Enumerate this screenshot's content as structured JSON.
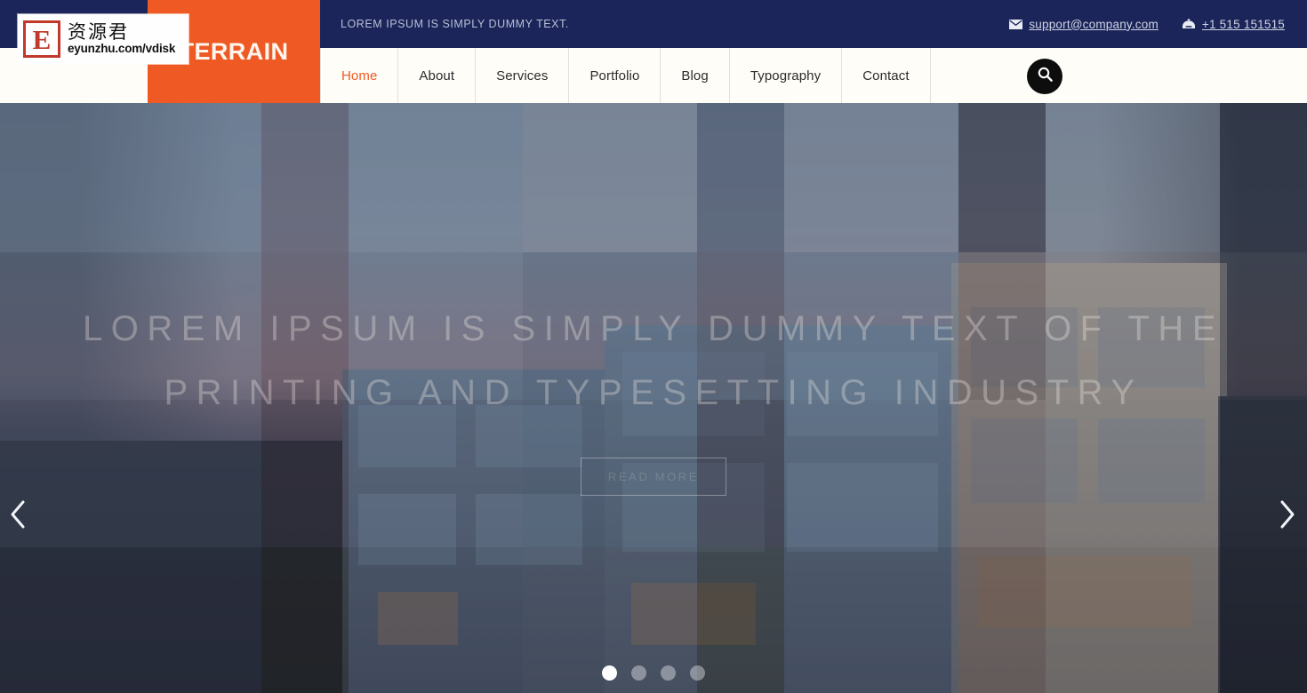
{
  "topbar": {
    "tagline": "LOREM IPSUM IS SIMPLY DUMMY TEXT.",
    "email": "support@company.com",
    "phone": "+1 515 151515",
    "email_icon": "envelope-icon",
    "phone_icon": "phone-icon",
    "bg_color": "#1b2559"
  },
  "logo": {
    "text": "TERRAIN",
    "bg_color": "#ef5a24",
    "text_color": "#fdf6ee"
  },
  "nav": {
    "bg_color": "#fffdf8",
    "active_color": "#ef5a24",
    "items": [
      {
        "label": "Home",
        "active": true
      },
      {
        "label": "About",
        "active": false
      },
      {
        "label": "Services",
        "active": false
      },
      {
        "label": "Portfolio",
        "active": false
      },
      {
        "label": "Blog",
        "active": false
      },
      {
        "label": "Typography",
        "active": false
      },
      {
        "label": "Contact",
        "active": false
      }
    ],
    "search_icon": "search-icon"
  },
  "hero": {
    "line1": "LOREM IPSUM IS SIMPLY DUMMY TEXT OF THE",
    "line2": "PRINTING AND TYPESETTING INDUSTRY",
    "button_label": "READ MORE",
    "prev_icon": "chevron-left-icon",
    "next_icon": "chevron-right-icon",
    "dots": [
      {
        "active": true
      },
      {
        "active": false
      },
      {
        "active": false
      },
      {
        "active": false
      }
    ]
  },
  "watermark": {
    "letter": "E",
    "chinese": "资源君",
    "url": "eyunzhu.com/vdisk",
    "accent_color": "#c0392b"
  }
}
